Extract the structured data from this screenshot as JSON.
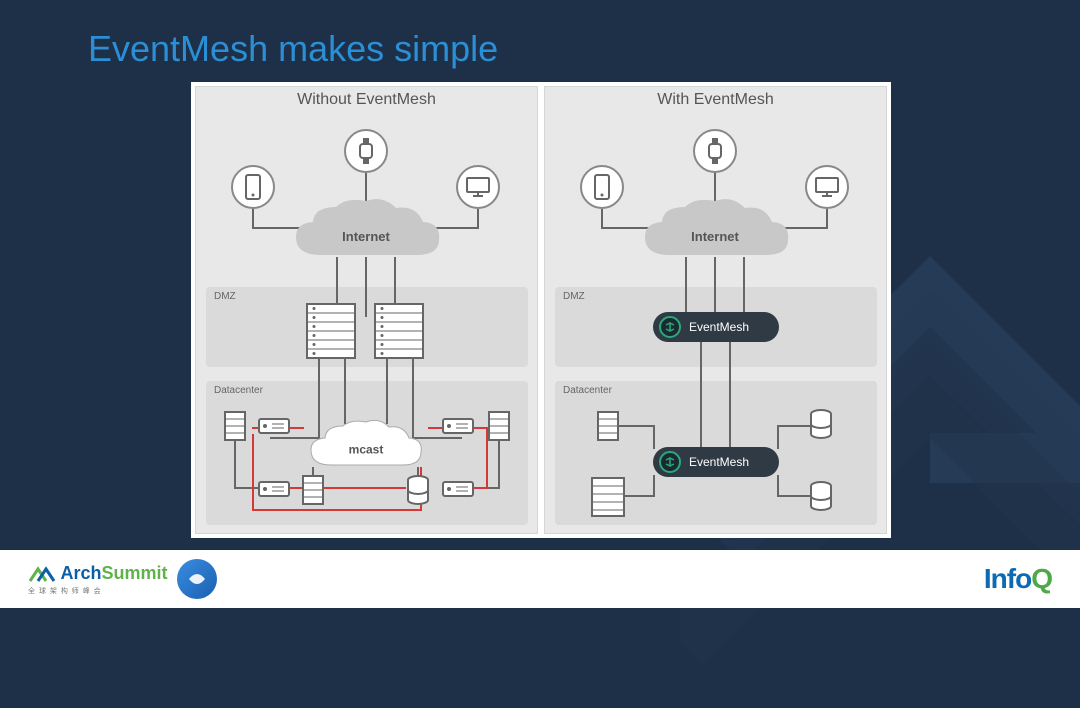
{
  "title": "EventMesh makes simple",
  "panels": {
    "left": {
      "title": "Without EventMesh",
      "internet_label": "Internet",
      "dmz_label": "DMZ",
      "datacenter_label": "Datacenter",
      "mcast_label": "mcast"
    },
    "right": {
      "title": "With EventMesh",
      "internet_label": "Internet",
      "dmz_label": "DMZ",
      "datacenter_label": "Datacenter",
      "pill1_label": "EventMesh",
      "pill2_label": "EventMesh"
    }
  },
  "footer": {
    "archsummit": {
      "arch": "Arch",
      "summit": "Summit",
      "sub": "全 球 架 构 师 峰 会"
    },
    "infoq": {
      "info": "Info",
      "q": "Q"
    }
  }
}
